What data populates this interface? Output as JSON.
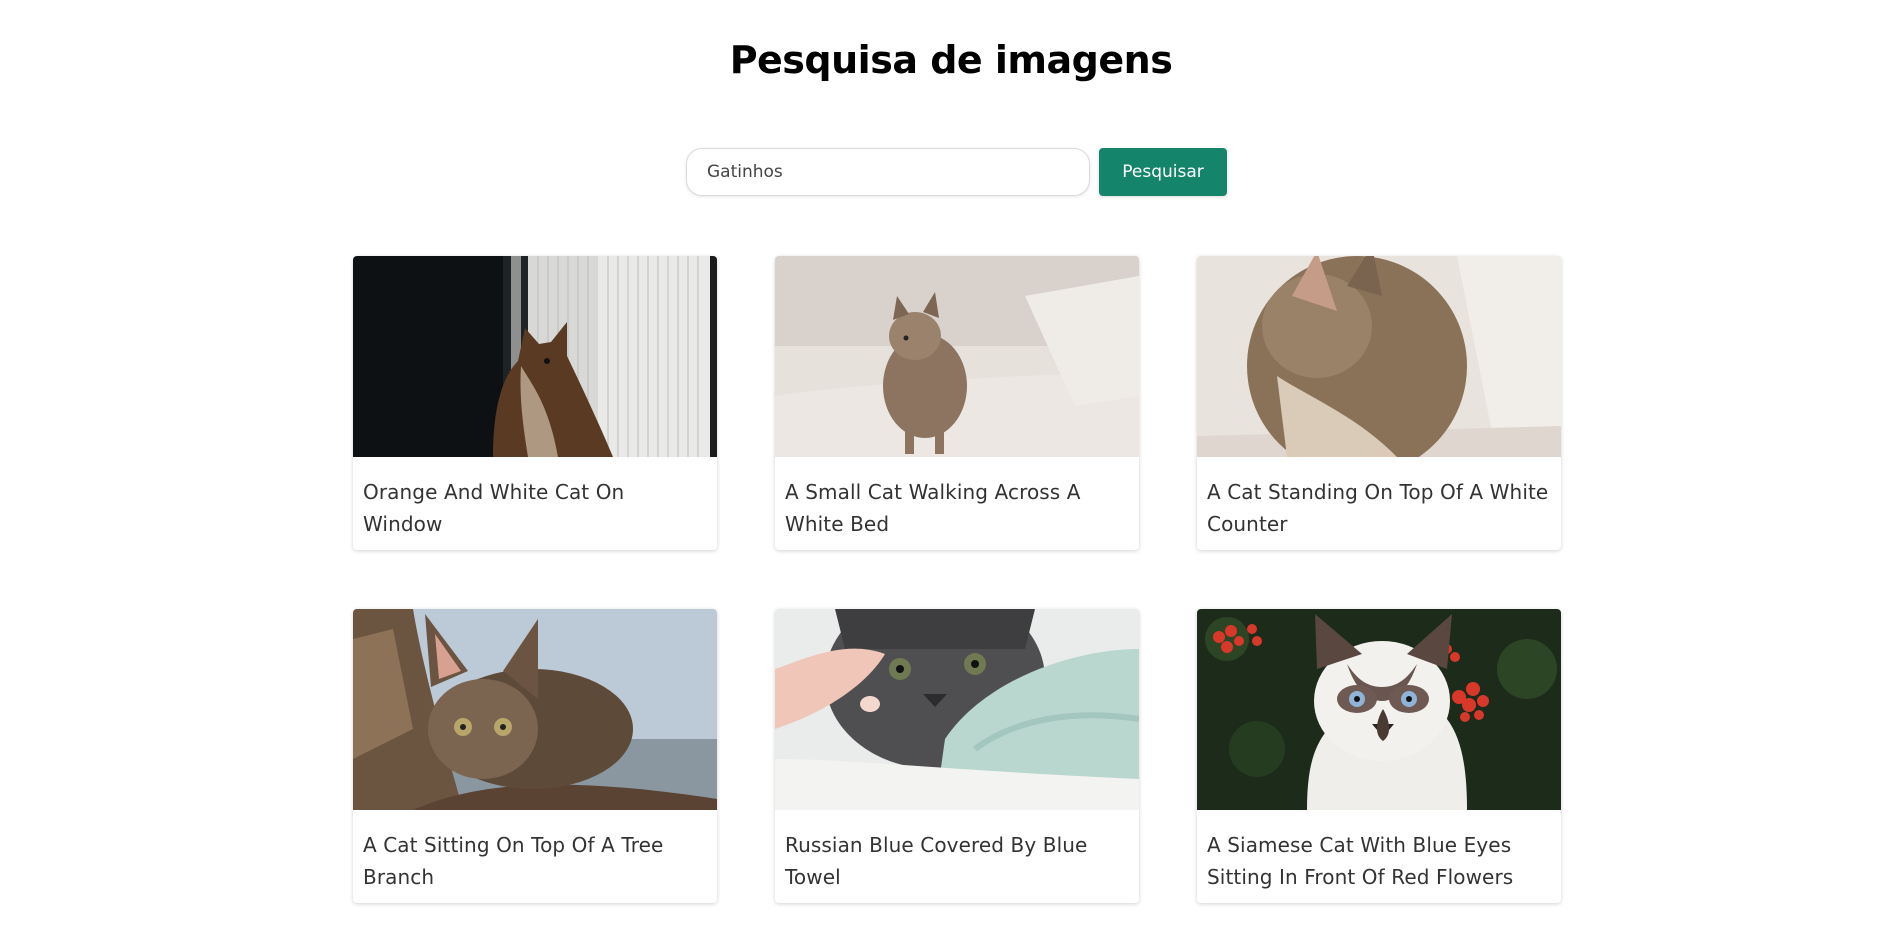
{
  "header": {
    "title": "Pesquisa de imagens"
  },
  "search": {
    "value": "Gatinhos",
    "button_label": "Pesquisar"
  },
  "colors": {
    "accent": "#14856a"
  },
  "results": [
    {
      "caption": "Orange And White Cat On Window",
      "image_icon": "cat-photo"
    },
    {
      "caption": "A Small Cat Walking Across A White Bed",
      "image_icon": "cat-photo"
    },
    {
      "caption": "A Cat Standing On Top Of A White Counter",
      "image_icon": "cat-photo"
    },
    {
      "caption": "A Cat Sitting On Top Of A Tree Branch",
      "image_icon": "cat-photo"
    },
    {
      "caption": "Russian Blue Covered By Blue Towel",
      "image_icon": "cat-photo"
    },
    {
      "caption": "A Siamese Cat With Blue Eyes Sitting In Front Of Red Flowers",
      "image_icon": "cat-photo"
    }
  ]
}
